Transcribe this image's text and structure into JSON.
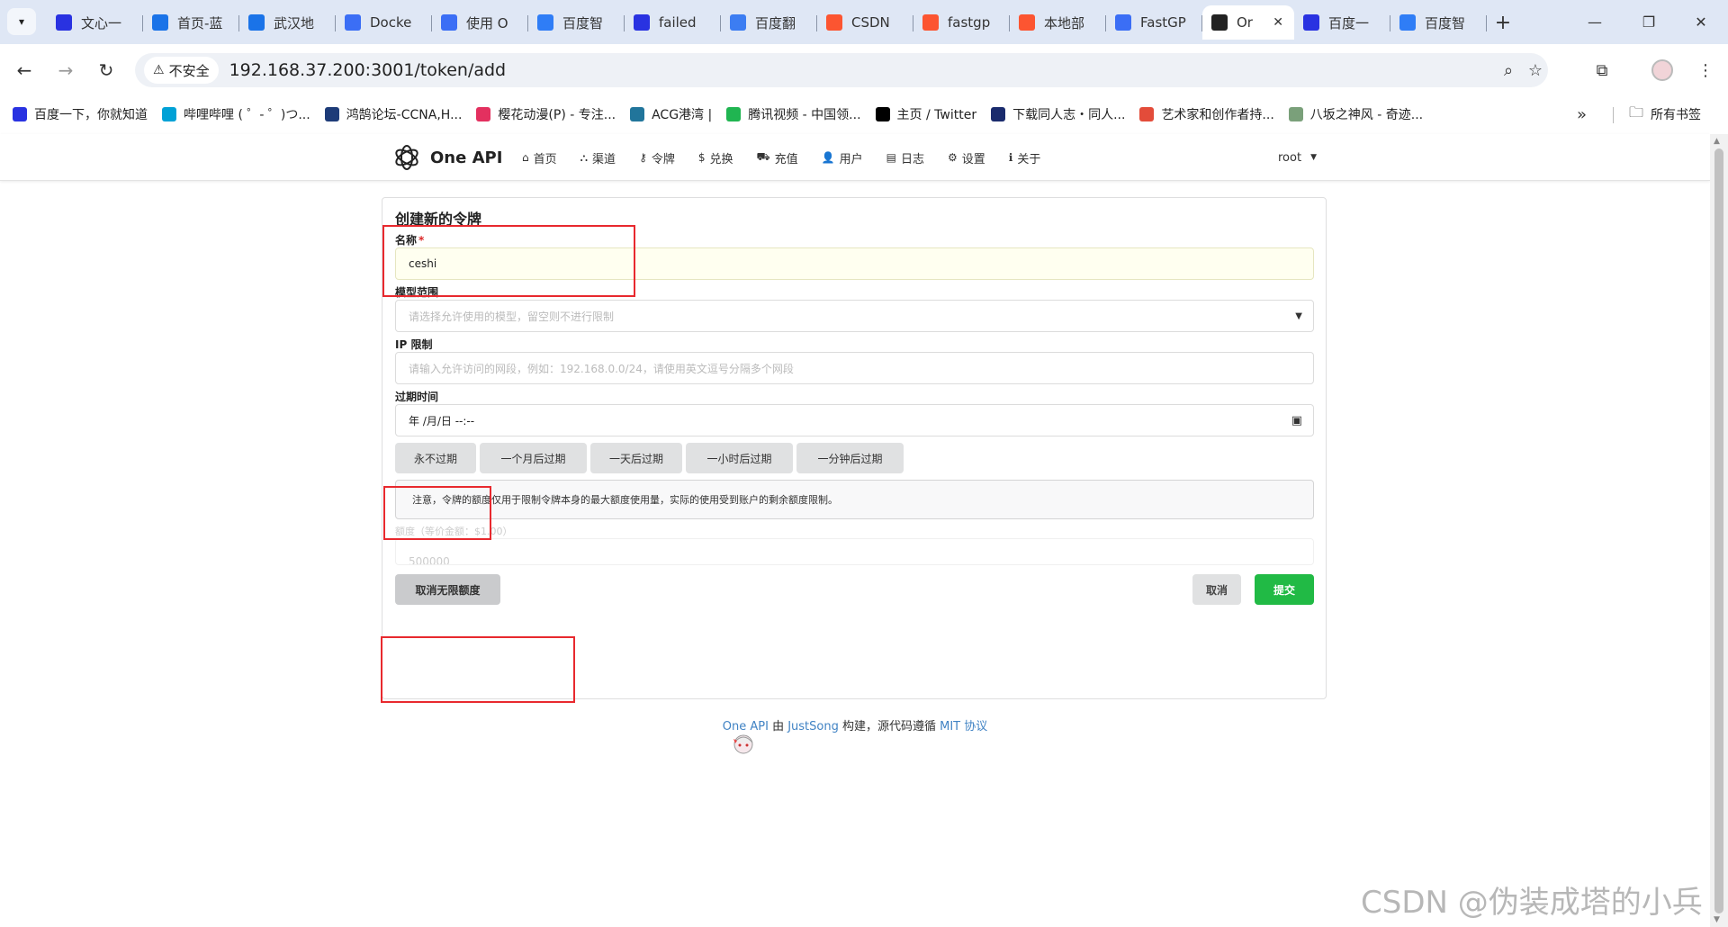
{
  "browser": {
    "tabs": [
      {
        "label": "文心一",
        "icon": "baidu-paw-icon",
        "color": "#2932e1"
      },
      {
        "label": "首页-蓝",
        "icon": "m-logo-icon",
        "color": "#1a73e8"
      },
      {
        "label": "武汉地",
        "icon": "m-logo-icon",
        "color": "#1a73e8"
      },
      {
        "label": "Docke",
        "icon": "f-logo-icon",
        "color": "#3b6ef5"
      },
      {
        "label": "使用 O",
        "icon": "f-logo-icon",
        "color": "#3b6ef5"
      },
      {
        "label": "百度智",
        "icon": "cube-icon",
        "color": "#2f7df6"
      },
      {
        "label": "failed",
        "icon": "baidu-paw-icon",
        "color": "#2932e1"
      },
      {
        "label": "百度翻",
        "icon": "translate-icon",
        "color": "#3c7df2"
      },
      {
        "label": "CSDN",
        "icon": "csdn-icon",
        "color": "#fc5531"
      },
      {
        "label": "fastgp",
        "icon": "csdn-icon",
        "color": "#fc5531"
      },
      {
        "label": "本地部",
        "icon": "csdn-icon",
        "color": "#fc5531"
      },
      {
        "label": "FastGP",
        "icon": "f-logo-icon",
        "color": "#3b6ef5"
      },
      {
        "label": "Or",
        "icon": "openai-icon",
        "color": "#222222",
        "active": true
      },
      {
        "label": "百度一",
        "icon": "baidu-paw-icon",
        "color": "#2932e1"
      },
      {
        "label": "百度智",
        "icon": "cube-icon",
        "color": "#2f7df6"
      }
    ],
    "security_label": "不安全",
    "url": "192.168.37.200:3001/token/add",
    "bookmarks": [
      {
        "label": "百度一下，你就知道",
        "color": "#2932e1"
      },
      {
        "label": "哔哩哔哩 ( ゜- ゜)つ...",
        "color": "#00a1d6"
      },
      {
        "label": "鸿鹄论坛-CCNA,H...",
        "color": "#1d3b78"
      },
      {
        "label": "樱花动漫(P) - 专注...",
        "color": "#e3305f"
      },
      {
        "label": "ACG港湾 |",
        "color": "#21759b"
      },
      {
        "label": "腾讯视频 - 中国领...",
        "color": "#20b551"
      },
      {
        "label": "主页 / Twitter",
        "color": "#000000"
      },
      {
        "label": "下载同人志・同人...",
        "color": "#1a2b6d"
      },
      {
        "label": "艺术家和创作者持...",
        "color": "#e34c3a"
      },
      {
        "label": "八坂之神风 - 奇迹...",
        "color": "#7aa07a"
      }
    ],
    "bookmarks_more": "»",
    "all_bookmarks": "所有书签"
  },
  "app": {
    "brand": "One API",
    "menu": [
      {
        "label": "首页",
        "icon": "home-icon",
        "glyph": "⌂"
      },
      {
        "label": "渠道",
        "icon": "sitemap-icon",
        "glyph": "⛬"
      },
      {
        "label": "令牌",
        "icon": "key-icon",
        "glyph": "⚷"
      },
      {
        "label": "兑换",
        "icon": "dollar-icon",
        "glyph": "$"
      },
      {
        "label": "充值",
        "icon": "cart-icon",
        "glyph": "⛟"
      },
      {
        "label": "用户",
        "icon": "user-icon",
        "glyph": "👤"
      },
      {
        "label": "日志",
        "icon": "book-icon",
        "glyph": "▤"
      },
      {
        "label": "设置",
        "icon": "gear-icon",
        "glyph": "⚙"
      },
      {
        "label": "关于",
        "icon": "info-icon",
        "glyph": "ℹ"
      }
    ],
    "user": "root"
  },
  "form": {
    "title": "创建新的令牌",
    "name_label": "名称",
    "required_mark": "*",
    "name_value": "ceshi",
    "models_label": "模型范围",
    "models_placeholder": "请选择允许使用的模型，留空则不进行限制",
    "ip_label": "IP 限制",
    "ip_placeholder": "请输入允许访问的网段，例如：192.168.0.0/24，请使用英文逗号分隔多个网段",
    "expire_label": "过期时间",
    "expire_value": "年 /月/日 --:--",
    "quick_expire": [
      "永不过期",
      "一个月后过期",
      "一天后过期",
      "一小时后过期",
      "一分钟后过期"
    ],
    "note": "注意，令牌的额度仅用于限制令牌本身的最大额度使用量，实际的使用受到账户的剩余额度限制。",
    "quota_label": "额度（等价金额：$1.00）",
    "quota_value": "500000",
    "unlimited_button": "取消无限额度",
    "cancel_button": "取消",
    "submit_button": "提交"
  },
  "footer": {
    "brand_link": "One API",
    "by": " 由 ",
    "author_link": "JustSong",
    "built": " 构建，源代码遵循 ",
    "license_link": "MIT 协议"
  },
  "watermark": "CSDN @伪装成塔的小兵",
  "colors": {
    "accent": "#4183c4",
    "submit": "#21ba45",
    "annotation": "#e8292e"
  }
}
